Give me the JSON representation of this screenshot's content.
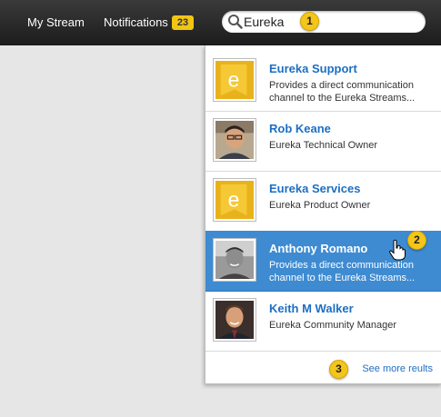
{
  "nav": {
    "my_stream": "My Stream",
    "notifications": "Notifications",
    "notifications_count": "23"
  },
  "search": {
    "value": "Eureka",
    "icon": "search-icon"
  },
  "callouts": [
    "1",
    "2",
    "3"
  ],
  "results": [
    {
      "name": "Eureka Support",
      "description": "Provides a direct communication channel to the Eureka Streams...",
      "avatar": "eureka-logo"
    },
    {
      "name": "Rob Keane",
      "description": "Eureka Technical Owner",
      "avatar": "person-photo"
    },
    {
      "name": "Eureka Services",
      "description": "Eureka Product Owner",
      "avatar": "eureka-logo"
    },
    {
      "name": "Anthony Romano",
      "description": "Provides a direct communication channel to the Eureka Streams...",
      "avatar": "person-photo",
      "selected": true
    },
    {
      "name": "Keith M Walker",
      "description": "Eureka Community Manager",
      "avatar": "person-photo"
    }
  ],
  "see_more": "See more reults",
  "colors": {
    "accent": "#3e8bd2",
    "link": "#1c6fc2",
    "badge": "#f3c513",
    "topbar": "#2a2a2a"
  }
}
